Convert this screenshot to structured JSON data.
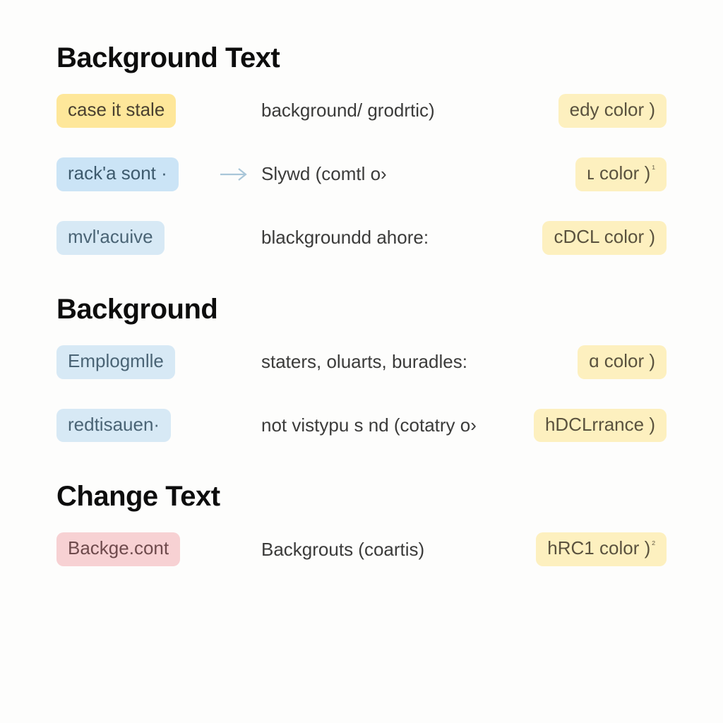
{
  "sections": [
    {
      "heading": "Background Text",
      "rows": [
        {
          "col1": {
            "text": "case it stale",
            "style": "chip-yellow"
          },
          "arrow": false,
          "col2": "background/ grodrtic)",
          "col3": {
            "text": "edy color )",
            "style": "chip-yellow-soft",
            "sup": ""
          }
        },
        {
          "col1": {
            "text": "rack'a sont ·",
            "style": "chip-blue"
          },
          "arrow": true,
          "col2": "Slywd (comtl o›",
          "col3": {
            "text": "ʟ color )",
            "style": "chip-yellow-soft",
            "sup": "¹"
          }
        },
        {
          "col1": {
            "text": "mvl'acuive",
            "style": "chip-blue-soft"
          },
          "arrow": false,
          "col2": "blackgroundd ahore:",
          "col3": {
            "text": "cDCL color )",
            "style": "chip-yellow-soft",
            "sup": ""
          }
        }
      ]
    },
    {
      "heading": "Background",
      "rows": [
        {
          "col1": {
            "text": "Emplogmlle",
            "style": "chip-blue-soft"
          },
          "arrow": false,
          "col2": "staters, oluarts, buradles:",
          "col3": {
            "text": "ɑ color )",
            "style": "chip-yellow-soft",
            "sup": ""
          }
        },
        {
          "col1": {
            "text": "redtisauen·",
            "style": "chip-blue-soft"
          },
          "arrow": false,
          "col2": "not vistypu s nd (cotatry o›",
          "col3": {
            "text": "hDCLrrance )",
            "style": "chip-yellow-soft",
            "sup": ""
          }
        }
      ]
    },
    {
      "heading": "Change Text",
      "rows": [
        {
          "col1": {
            "text": "Backge.cont",
            "style": "chip-pink"
          },
          "arrow": false,
          "col2": "Backgrouts (coartis)",
          "col3": {
            "text": "hRC1 color )",
            "style": "chip-yellow-soft",
            "sup": "²"
          }
        }
      ]
    }
  ]
}
